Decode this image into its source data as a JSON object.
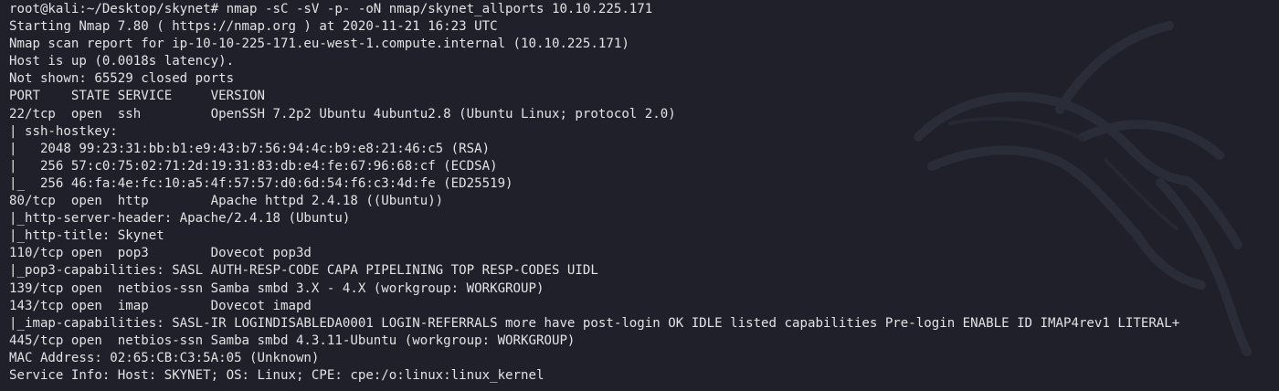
{
  "terminal": {
    "lines": [
      "root@kali:~/Desktop/skynet# nmap -sC -sV -p- -oN nmap/skynet_allports 10.10.225.171",
      "Starting Nmap 7.80 ( https://nmap.org ) at 2020-11-21 16:23 UTC",
      "Nmap scan report for ip-10-10-225-171.eu-west-1.compute.internal (10.10.225.171)",
      "Host is up (0.0018s latency).",
      "Not shown: 65529 closed ports",
      "PORT    STATE SERVICE     VERSION",
      "22/tcp  open  ssh         OpenSSH 7.2p2 Ubuntu 4ubuntu2.8 (Ubuntu Linux; protocol 2.0)",
      "| ssh-hostkey:",
      "|   2048 99:23:31:bb:b1:e9:43:b7:56:94:4c:b9:e8:21:46:c5 (RSA)",
      "|   256 57:c0:75:02:71:2d:19:31:83:db:e4:fe:67:96:68:cf (ECDSA)",
      "|_  256 46:fa:4e:fc:10:a5:4f:57:57:d0:6d:54:f6:c3:4d:fe (ED25519)",
      "80/tcp  open  http        Apache httpd 2.4.18 ((Ubuntu))",
      "|_http-server-header: Apache/2.4.18 (Ubuntu)",
      "|_http-title: Skynet",
      "110/tcp open  pop3        Dovecot pop3d",
      "|_pop3-capabilities: SASL AUTH-RESP-CODE CAPA PIPELINING TOP RESP-CODES UIDL",
      "139/tcp open  netbios-ssn Samba smbd 3.X - 4.X (workgroup: WORKGROUP)",
      "143/tcp open  imap        Dovecot imapd",
      "|_imap-capabilities: SASL-IR LOGINDISABLEDA0001 LOGIN-REFERRALS more have post-login OK IDLE listed capabilities Pre-login ENABLE ID IMAP4rev1 LITERAL+",
      "445/tcp open  netbios-ssn Samba smbd 4.3.11-Ubuntu (workgroup: WORKGROUP)",
      "MAC Address: 02:65:CB:C3:5A:05 (Unknown)",
      "Service Info: Host: SKYNET; OS: Linux; CPE: cpe:/o:linux:linux_kernel"
    ]
  },
  "colors": {
    "background": "#1f2029",
    "text": "#e1e3e6",
    "watermark": "#2a2c38"
  },
  "watermark_icon": "kali-dragon-icon"
}
